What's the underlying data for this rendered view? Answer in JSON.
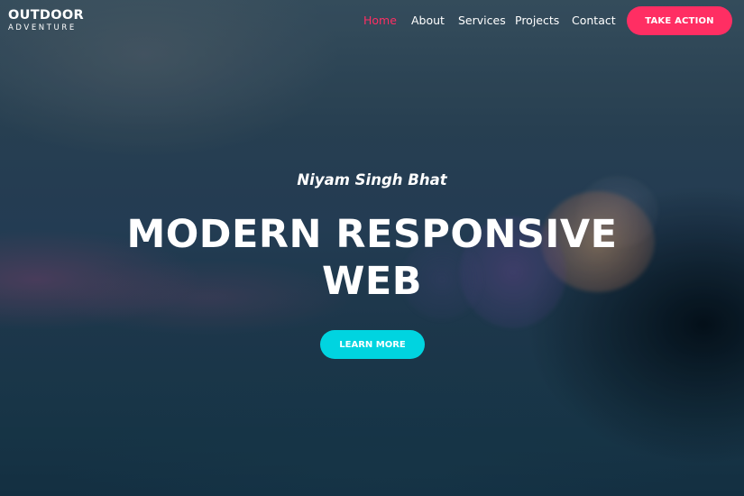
{
  "navbar": {
    "logo_top": "OUTDOOR",
    "logo_bottom": "ADVENTURE",
    "links": [
      {
        "label": "Home",
        "active": true
      },
      {
        "label": "About",
        "active": false
      },
      {
        "label": "Services",
        "active": false
      },
      {
        "label": "Projects",
        "active": false
      },
      {
        "label": "Contact",
        "active": false
      }
    ],
    "cta_label": "TAKE ACTION"
  },
  "hero": {
    "subtitle": "Niyam Singh Bhat",
    "title_line1": "MODERN RESPONSIVE",
    "title_line2": "WEB",
    "button_label": "LEARN MORE"
  },
  "colors": {
    "accent": "#ff2e63",
    "button_secondary": "#00d4e0",
    "text": "#ffffff"
  }
}
